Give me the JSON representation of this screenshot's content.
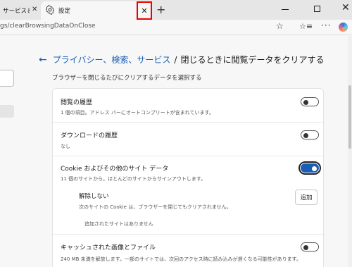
{
  "tabs": {
    "inactive_title": "サービス＆サ",
    "inactive_close": "✕",
    "active_title": "設定",
    "active_close": "✕",
    "new_tab": "+"
  },
  "window_controls": {
    "close": "✕"
  },
  "address_bar": {
    "url": "gs/clearBrowsingDataOnClose",
    "star_icon": "☆",
    "favorites_icon": "☆≡",
    "more_icon": "···"
  },
  "header": {
    "back": "←",
    "crumb_link": "プライバシー、検索、サービス",
    "separator": "/",
    "current": "閉じるときに閲覧データをクリアする"
  },
  "subtitle": "ブラウザーを閉じるたびにクリアするデータを選択する",
  "rows": [
    {
      "title": "閲覧の履歴",
      "desc": "1 個の項目。アドレス バーにオートコンプリートが含まれています。",
      "enabled": false
    },
    {
      "title": "ダウンロードの履歴",
      "desc": "なし",
      "enabled": false
    },
    {
      "title": "Cookie およびその他のサイト データ",
      "desc": "11 個のサイトから。ほとんどのサイトからサインアウトします。",
      "enabled": true
    },
    {
      "title": "キャッシュされた画像とファイル",
      "desc": "240 MB 未満を解放します。一部のサイトでは、次回のアクセス時に読み込みが遅くなる可能性があります。",
      "enabled": false
    }
  ],
  "exceptions": {
    "title": "解除しない",
    "desc": "次のサイトの Cookie は、ブラウザーを閉じてもクリアされません。",
    "add_label": "追加",
    "empty": "追加されたサイトはありません"
  },
  "colors": {
    "accent": "#1a5fb4",
    "highlight": "#e00000"
  }
}
